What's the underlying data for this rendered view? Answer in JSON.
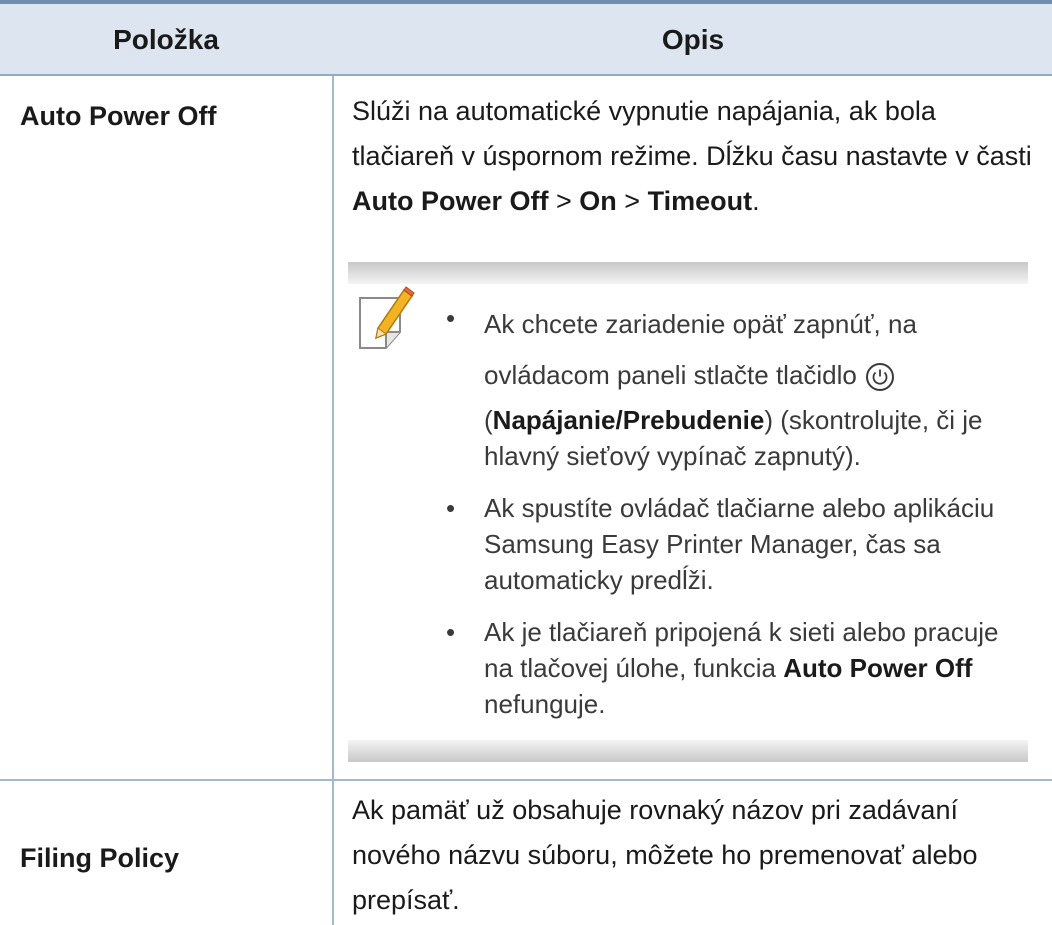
{
  "table": {
    "header": {
      "col1": "Položka",
      "col2": "Opis"
    },
    "rows": [
      {
        "item": "Auto Power Off",
        "desc": {
          "part1": "Slúži na automatické vypnutie napájania, ak bola tlačiareň v úspornom režime. Dĺžku času nastavte v časti ",
          "bold1": "Auto Power Off",
          "sep1": " > ",
          "bold2": "On",
          "sep2": " > ",
          "bold3": "Timeout",
          "end": "."
        },
        "note": {
          "icon": "note-pencil-icon",
          "bullet1": {
            "line1": "Ak chcete zariadenie opäť zapnúť, na",
            "line2": "ovládacom paneli stlačte tlačidlo",
            "power_icon": "power-icon",
            "open_paren": "(",
            "bold": "Napájanie/Prebudenie",
            "rest": ") (skontrolujte, či je hlavný sieťový vypínač zapnutý)."
          },
          "bullet2": "Ak spustíte ovládač tlačiarne alebo aplikáciu Samsung Easy Printer Manager, čas sa automaticky predĺži.",
          "bullet3": {
            "text": "Ak je tlačiareň pripojená k sieti alebo pracuje na tlačovej úlohe, funkcia ",
            "bold": "Auto Power Off",
            "end": " nefunguje."
          }
        }
      },
      {
        "item": "Filing Policy",
        "desc": "Ak pamäť už obsahuje rovnaký názov pri zadávaní nového názvu súboru, môžete ho premenovať alebo prepísať."
      }
    ]
  },
  "colors": {
    "header_bg": "#dde6f0",
    "top_rule": "#6f8fb2",
    "divider": "#a4b7cc"
  }
}
